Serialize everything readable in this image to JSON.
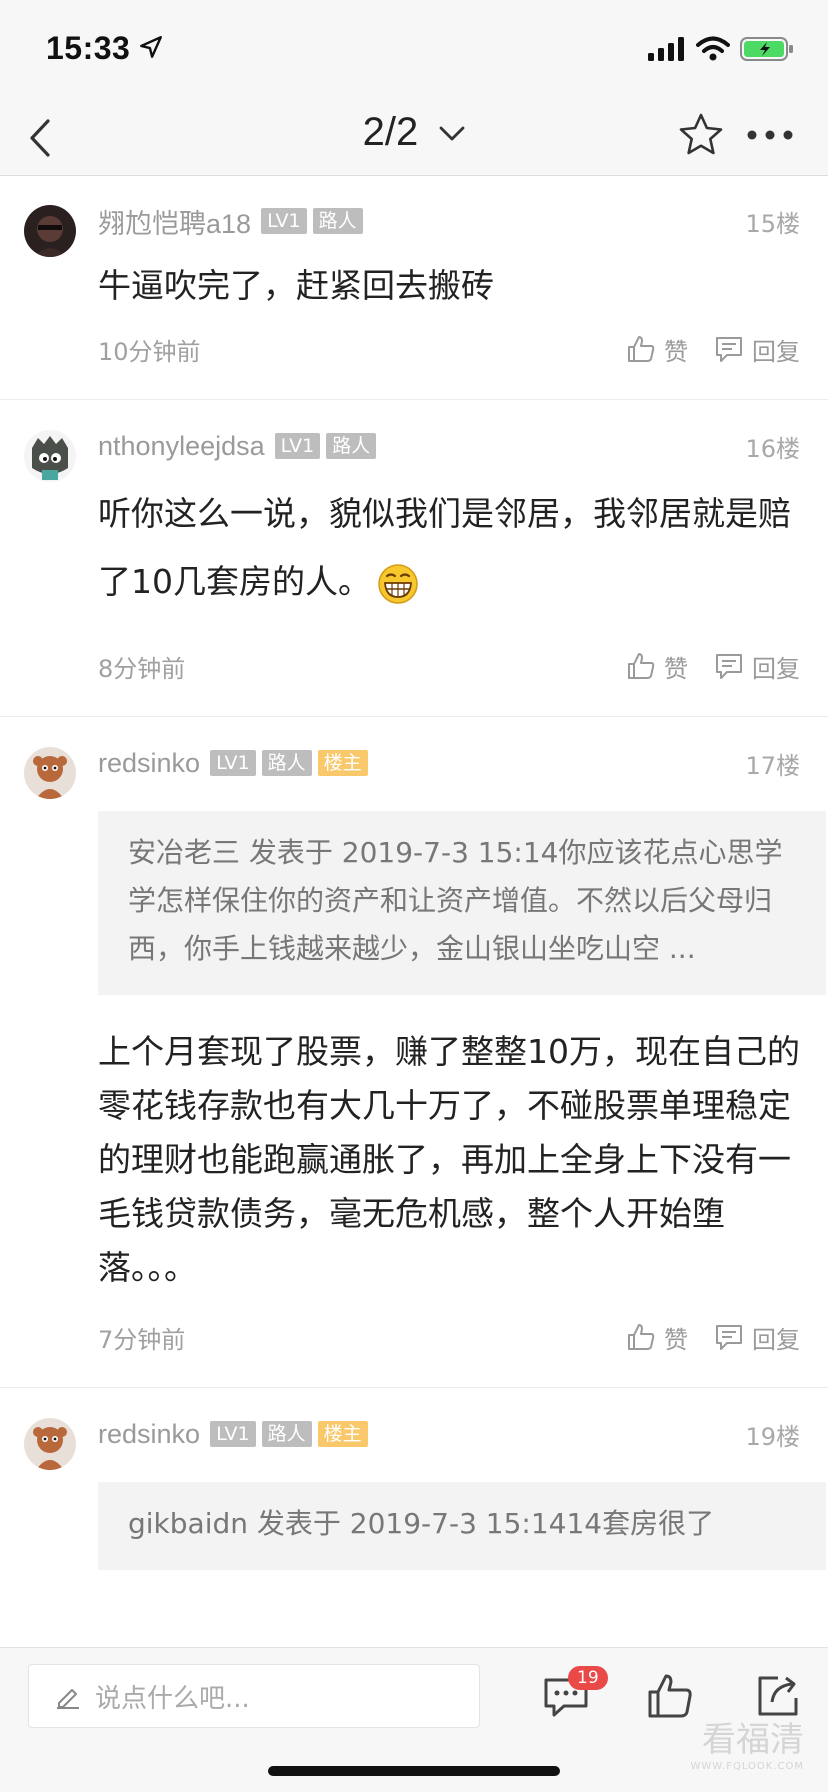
{
  "status": {
    "time": "15:33"
  },
  "nav": {
    "title": "2/2"
  },
  "posts": [
    {
      "username": "翙尥恺聘a18",
      "level": "LV1",
      "role": "路人",
      "floor": "15楼",
      "content": "牛逼吹完了，赶紧回去搬砖",
      "time": "10分钟前",
      "like_label": "赞",
      "reply_label": "回复"
    },
    {
      "username": "nthonyleejdsa",
      "level": "LV1",
      "role": "路人",
      "floor": "16楼",
      "content": "听你这么一说，貌似我们是邻居，我邻居就是赔了10几套房的人。",
      "time": "8分钟前",
      "like_label": "赞",
      "reply_label": "回复"
    },
    {
      "username": "redsinko",
      "level": "LV1",
      "role": "路人",
      "owner": "楼主",
      "floor": "17楼",
      "quote": "安冶老三 发表于 2019-7-3 15:14你应该花点心思学学怎样保住你的资产和让资产增值。不然以后父母归西，你手上钱越来越少，金山银山坐吃山空 ...",
      "content": "上个月套现了股票，赚了整整10万，现在自己的零花钱存款也有大几十万了，不碰股票单理稳定的理财也能跑赢通胀了，再加上全身上下没有一毛钱贷款债务，毫无危机感，整个人开始堕落。。。",
      "time": "7分钟前",
      "like_label": "赞",
      "reply_label": "回复"
    },
    {
      "username": "redsinko",
      "level": "LV1",
      "role": "路人",
      "owner": "楼主",
      "floor": "19楼",
      "quote": "gikbaidn 发表于 2019-7-3 15:1414套房很了"
    }
  ],
  "bottom": {
    "placeholder": "说点什么吧...",
    "comment_count": "19",
    "watermark": "看福清",
    "watermark_url": "WWW.FQLOOK.COM"
  },
  "icons": {
    "back": "chevron-left-icon",
    "dropdown": "chevron-down-icon",
    "star": "star-icon",
    "more": "more-icon",
    "like": "thumb-up-icon",
    "reply": "comment-icon",
    "pen": "pen-icon",
    "share": "share-icon"
  }
}
